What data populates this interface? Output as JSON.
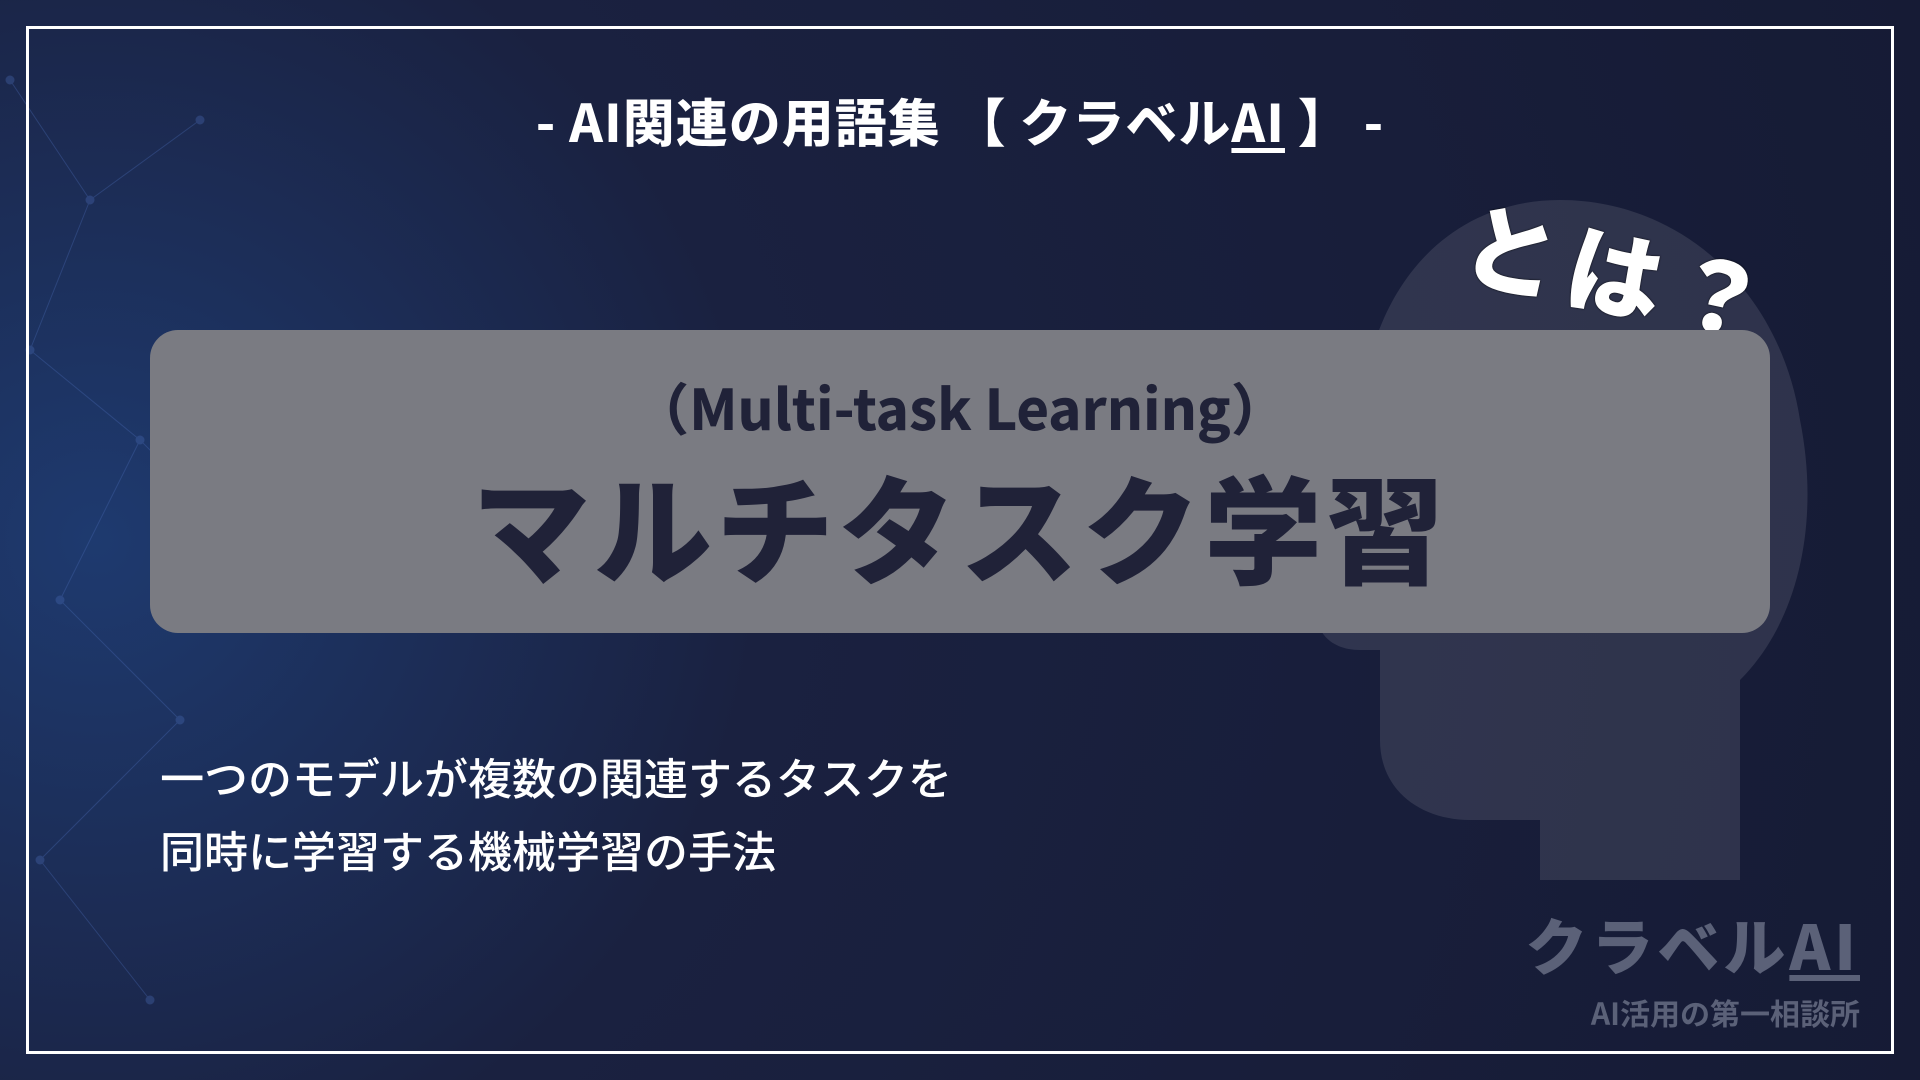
{
  "header": {
    "prefix": "- AI関連の用語集 【 クラベル",
    "ai": "AI",
    "suffix": " 】 -"
  },
  "term": {
    "english": "（Multi-task Learning）",
    "japanese": "マルチタスク学習"
  },
  "question_label": "とは？",
  "description": {
    "line1": "一つのモデルが複数の関連するタスクを",
    "line2": "同時に学習する機械学習の手法"
  },
  "logo": {
    "name_prefix": "クラベル",
    "name_ai": "AI",
    "tagline": "AI活用の第一相談所"
  }
}
